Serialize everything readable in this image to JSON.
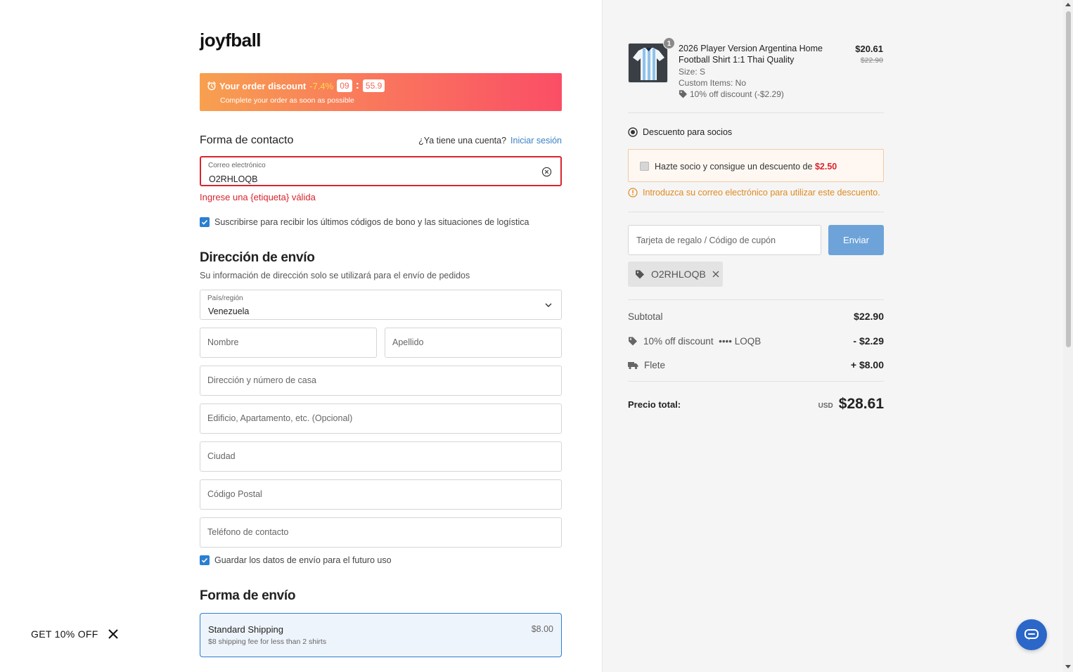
{
  "store": {
    "logo": "joyfball"
  },
  "banner": {
    "label": "Your order discount",
    "percent": "-7.4%",
    "minutes": "09",
    "seconds": "55.9",
    "subtitle": "Complete your order as soon as possible"
  },
  "contact": {
    "title": "Forma de contacto",
    "account_question": "¿Ya tiene una cuenta?",
    "login_link": "Iniciar sesión",
    "email_label": "Correo electrónico",
    "email_value": "O2RHLOQB",
    "error": "Ingrese una {etiqueta} válida",
    "subscribe_label": "Suscribirse para recibir los últimos códigos de bono y las situaciones de logística",
    "subscribe_checked": true
  },
  "shipping_address": {
    "title": "Dirección de envío",
    "subtitle": "Su información de dirección solo se utilizará para el envío de pedidos",
    "country_label": "País/región",
    "country_value": "Venezuela",
    "first_name_placeholder": "Nombre",
    "last_name_placeholder": "Apellido",
    "address_placeholder": "Dirección y número de casa",
    "address2_placeholder": "Edificio, Apartamento, etc. (Opcional)",
    "city_placeholder": "Ciudad",
    "postal_placeholder": "Código Postal",
    "phone_placeholder": "Teléfono de contacto",
    "save_label": "Guardar los datos de envío para el futuro uso",
    "save_checked": true
  },
  "shipping_method": {
    "title": "Forma de envío",
    "option_title": "Standard Shipping",
    "option_desc": "$8 shipping fee for less than 2 shirts",
    "option_price": "$8.00"
  },
  "promo": {
    "label": "GET 10% OFF"
  },
  "cart": {
    "item": {
      "quantity": "1",
      "name": "2026 Player Version Argentina Home Football Shirt 1:1 Thai Quality",
      "size": "Size: S",
      "custom": "Custom Items: No",
      "discount": "10% off discount (-$2.29)",
      "price": "$20.61",
      "old_price": "$22.90"
    },
    "member": {
      "title": "Descuento para socios",
      "offer_text": "Hazte socio y consigue un descuento de",
      "offer_amount": "$2.50",
      "warning": "Introduzca su correo electrónico para utilizar este descuento."
    },
    "coupon": {
      "placeholder": "Tarjeta de regalo / Código de cupón",
      "button": "Enviar",
      "applied_code": "O2RHLOQB"
    },
    "summary": {
      "subtotal_label": "Subtotal",
      "subtotal": "$22.90",
      "discount_label": "10% off discount",
      "discount_code": "•••• LOQB",
      "discount": "- $2.29",
      "freight_label": "Flete",
      "freight": "+ $8.00",
      "total_label": "Precio total:",
      "currency": "USD",
      "total": "$28.61"
    }
  },
  "colors": {
    "accent": "#2b7fd1",
    "error": "#d9242e",
    "warning": "#e08a1f",
    "banner_start": "#f7a04f",
    "banner_end": "#fb4e66"
  }
}
